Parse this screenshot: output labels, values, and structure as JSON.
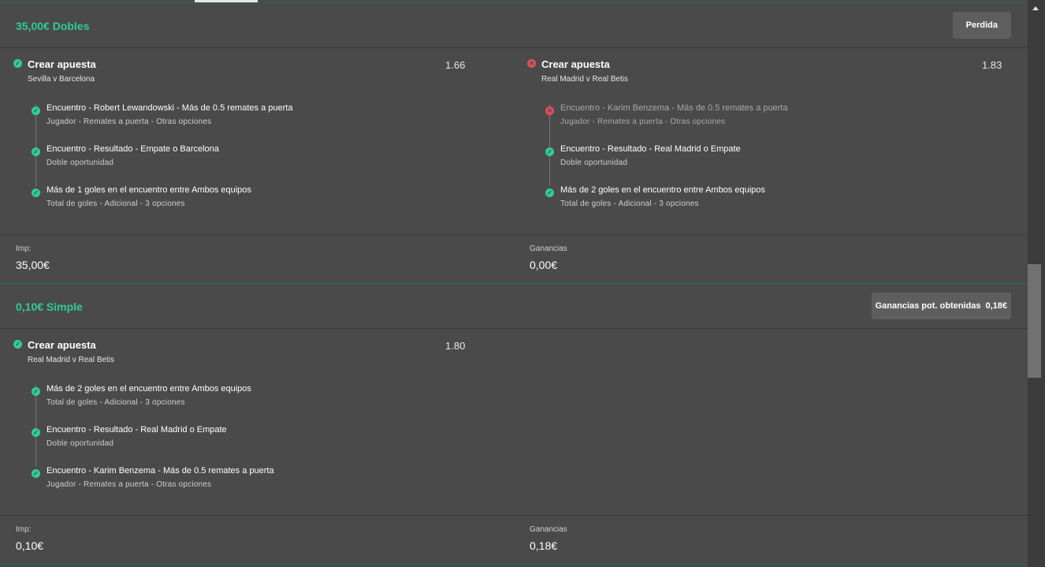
{
  "slips": [
    {
      "title": "35,00€ Dobles",
      "status": "Perdida",
      "selections": [
        {
          "result": "won",
          "title": "Crear apuesta",
          "event": "Sevilla v Barcelona",
          "odds": "1.66",
          "legs": [
            {
              "result": "won",
              "name": "Encuentro - Robert Lewandowski - Más de 0.5 remates a puerta",
              "desc": "Jugador - Remates a puerta - Otras opciones"
            },
            {
              "result": "won",
              "name": "Encuentro - Resultado - Empate o Barcelona",
              "desc": "Doble oportunidad"
            },
            {
              "result": "won",
              "name": "Más de 1 goles en el encuentro entre Ambos equipos",
              "desc": "Total de goles - Adicional - 3 opciones"
            }
          ]
        },
        {
          "result": "lost",
          "title": "Crear apuesta",
          "event": "Real Madrid v Real Betis",
          "odds": "1.83",
          "legs": [
            {
              "result": "lost",
              "name": "Encuentro - Karim Benzema - Más de 0.5 remates a puerta",
              "desc": "Jugador - Remates a puerta - Otras opciones"
            },
            {
              "result": "won",
              "name": "Encuentro - Resultado - Real Madrid o Empate",
              "desc": "Doble oportunidad"
            },
            {
              "result": "won",
              "name": "Más de 2 goles en el encuentro entre Ambos equipos",
              "desc": "Total de goles - Adicional - 3 opciones"
            }
          ]
        }
      ],
      "stake_label": "Imp:",
      "stake_value": "35,00€",
      "returns_label": "Ganancias",
      "returns_value": "0,00€"
    },
    {
      "title": "0,10€ Simple",
      "status": "Ganancias pot. obtenidas",
      "status_amount": "0,18€",
      "selections": [
        {
          "result": "won",
          "title": "Crear apuesta",
          "event": "Real Madrid v Real Betis",
          "odds": "1.80",
          "legs": [
            {
              "result": "won",
              "name": "Más de 2 goles en el encuentro entre Ambos equipos",
              "desc": "Total de goles - Adicional - 3 opciones"
            },
            {
              "result": "won",
              "name": "Encuentro - Resultado - Real Madrid o Empate",
              "desc": "Doble oportunidad"
            },
            {
              "result": "won",
              "name": "Encuentro - Karim Benzema - Más de 0.5 remates a puerta",
              "desc": "Jugador - Remates a puerta - Otras opciones"
            }
          ]
        }
      ],
      "stake_label": "Imp:",
      "stake_value": "0,10€",
      "returns_label": "Ganancias",
      "returns_value": "0,18€"
    }
  ],
  "colors": {
    "accent": "#2ecc9a",
    "lost": "#e14d5a",
    "background": "#4a4a4a"
  }
}
